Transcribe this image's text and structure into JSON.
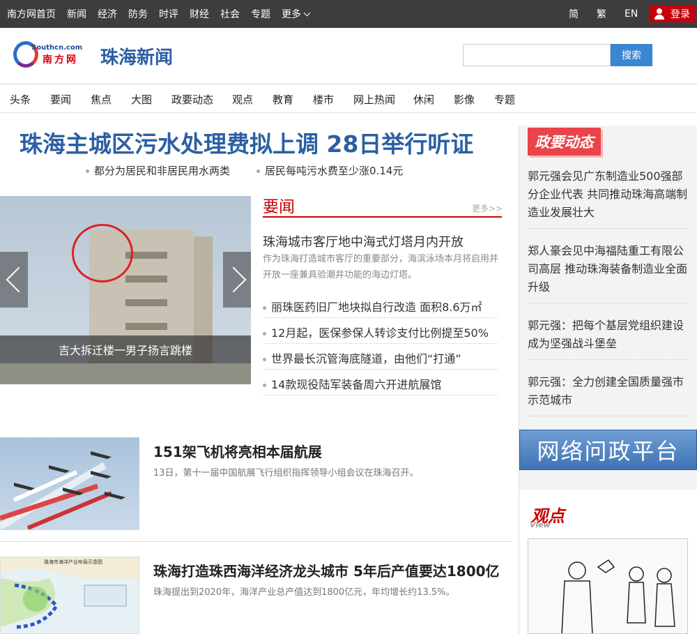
{
  "topbar": {
    "nav": [
      "南方网首页",
      "新闻",
      "经济",
      "防务",
      "时评",
      "财经",
      "社会",
      "专题",
      "更多"
    ],
    "lang": [
      "简",
      "繁",
      "EN"
    ],
    "login": "登录"
  },
  "header": {
    "logo_en": "Southcn.com",
    "logo_cn": "南方网",
    "site_title": "珠海新闻",
    "search_button": "搜索",
    "search_value": ""
  },
  "nav": [
    "头条",
    "要闻",
    "焦点",
    "大图",
    "政要动态",
    "观点",
    "教育",
    "楼市",
    "网上热闻",
    "休闲",
    "影像",
    "专题"
  ],
  "headline": {
    "title": "珠海主城区污水处理费拟上调 28日举行听证",
    "subs": [
      "都分为居民和非居民用水两类",
      "居民每吨污水费至少涨0.14元"
    ]
  },
  "slideshow": {
    "caption": "吉大拆迁楼一男子扬言跳楼"
  },
  "yaowen": {
    "title": "要闻",
    "more": "更多>>",
    "lead_title": "珠海城市客厅地中海式灯塔月内开放",
    "lead_desc": "作为珠海打造城市客厅的重要部分，海滨泳场本月将启用并开放一座兼具验潮井功能的海边灯塔。",
    "items": [
      "丽珠医药旧厂地块拟自行改造 面积8.6万㎡",
      "12月起，医保参保人转诊支付比例提至50%",
      "世界最长沉管海底隧道，由他们“打通”",
      "14款现役陆军装备周六开进航展馆"
    ]
  },
  "stories": [
    {
      "title": "151架飞机将亮相本届航展",
      "desc": "13日，第十一届中国航展飞行组织指挥领导小组会议在珠海召开。"
    },
    {
      "title": "珠海打造珠西海洋经济龙头城市 5年后产值要达1800亿",
      "desc": "珠海提出到2020年，海洋产业总产值达到1800亿元，年均增长约13.5%。",
      "map_label": "珠海市海洋产业布局示意图"
    }
  ],
  "sidebar": {
    "badge": "政要动态",
    "items": [
      "郭元强会见广东制造业500强部分企业代表 共同推动珠海高端制造业发展壮大",
      "郑人豪会见中海福陆重工有限公司高层 推动珠海装备制造业全面升级",
      "郭元强：把每个基层党组织建设成为坚强战斗堡垒",
      "郭元强：全力创建全国质量强市示范城市"
    ],
    "banner": "网络问政平台",
    "view_cn": "观点",
    "view_en": "View"
  },
  "colors": {
    "topbar": "#3d3d3d",
    "brand_blue": "#2b5fa4",
    "accent_red": "#c00000",
    "search_button": "#3b86d4",
    "sidebar_bg": "#f3f3f3"
  }
}
